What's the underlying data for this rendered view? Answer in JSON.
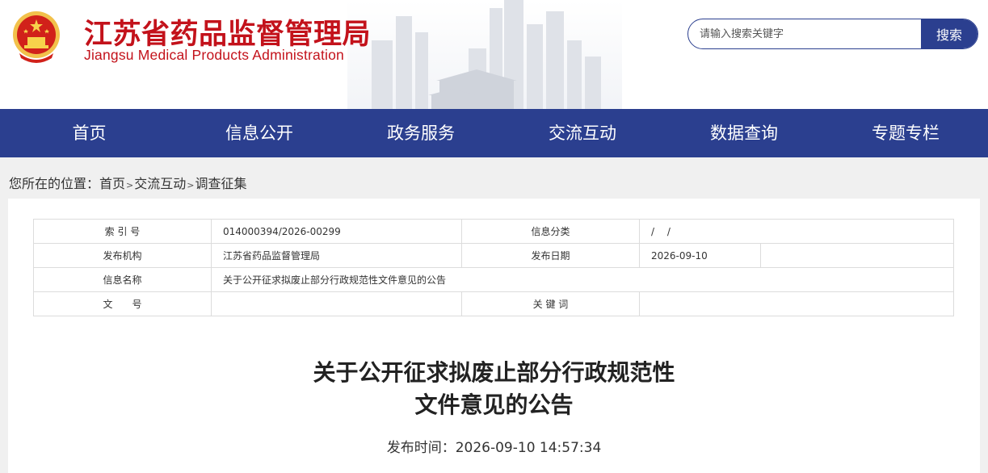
{
  "header": {
    "site_name_cn": "江苏省药品监督管理局",
    "site_name_en": "Jiangsu Medical Products Administration",
    "brand_color": "#c3121b",
    "search": {
      "placeholder": "请输入搜索关键字",
      "button_label": "搜索"
    }
  },
  "nav": {
    "color": "#2b3f8f",
    "items": [
      {
        "label": "首页"
      },
      {
        "label": "信息公开"
      },
      {
        "label": "政务服务"
      },
      {
        "label": "交流互动"
      },
      {
        "label": "数据查询"
      },
      {
        "label": "专题专栏"
      }
    ]
  },
  "breadcrumb": {
    "prefix": "您所在的位置：",
    "separator": ">",
    "items": [
      {
        "label": "首页"
      },
      {
        "label": "交流互动"
      },
      {
        "label": "调查征集"
      }
    ]
  },
  "meta": {
    "index_label": "索 引 号",
    "index_value": "014000394/2026-00299",
    "category_label": "信息分类",
    "category_value": "/　 /",
    "publisher_label": "发布机构",
    "publisher_value": "江苏省药品监督管理局",
    "date_label": "发布日期",
    "date_value": "2026-09-10",
    "name_label": "信息名称",
    "name_value": "关于公开征求拟废止部分行政规范性文件意见的公告",
    "docno_label": "文　　号",
    "docno_value": "",
    "keywords_label": "关 键 词",
    "keywords_value": ""
  },
  "article": {
    "title_line1": "关于公开征求拟废止部分行政规范性",
    "title_line2": "文件意见的公告",
    "publish_time": "发布时间：2026-09-10 14:57:34"
  }
}
